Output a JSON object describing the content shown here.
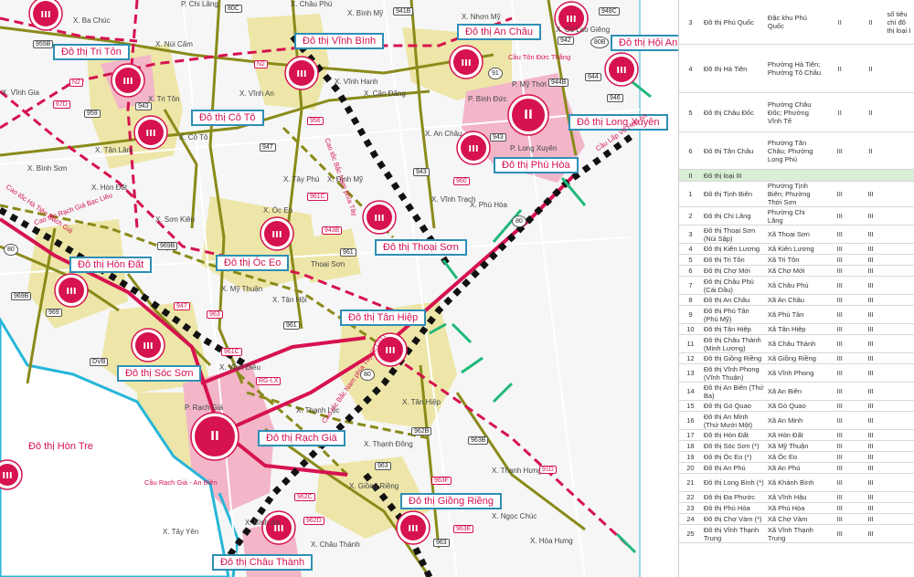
{
  "colors": {
    "urban_red": "#d6124f",
    "label_border": "#2f8fb5",
    "label_text": "#d6124f",
    "yellow_zone": "#ede6a8",
    "pink_zone": "#f2b6c8",
    "olive_road": "#8a8a1a",
    "river": "#27b6d8",
    "arrow": "#1fb879",
    "group_row": "#d9efd5"
  },
  "markers": [
    {
      "text": "III"
    },
    {
      "text": "III"
    },
    {
      "text": "III"
    },
    {
      "text": "III"
    },
    {
      "text": "III"
    },
    {
      "text": "III"
    },
    {
      "text": "III"
    },
    {
      "text": "II"
    },
    {
      "text": "III"
    },
    {
      "text": "III"
    },
    {
      "text": "III"
    },
    {
      "text": "III"
    },
    {
      "text": "III"
    },
    {
      "text": "III"
    },
    {
      "text": "III"
    },
    {
      "text": "II"
    },
    {
      "text": "III"
    },
    {
      "text": "III"
    },
    {
      "text": "III"
    },
    {
      "text": "III"
    },
    {
      "text": "III"
    }
  ],
  "city_labels": [
    "Đô thị Tri Tôn",
    "Đô thị Vĩnh Bình",
    "Đô thị An Châu",
    "Đô thị Hội An",
    "Đô thị Cô Tô",
    "Đô thị Long Xuyên",
    "Đô thị Phú Hòa",
    "Đô thị Thoại Sơn",
    "Đô thị Hòn Đất",
    "Đô thị Óc Eo",
    "Đô thị Tân Hiệp",
    "Đô thị Sóc Sơn",
    "Đô thị Hòn Tre",
    "Đô thị Rạch Giá",
    "Đô thị Giồng Riềng",
    "Đô thị Châu Thành"
  ],
  "place_labels": [
    "X. Ba Chúc",
    "P. Chi Lăng",
    "X. Châu Phú",
    "X. Bình Mỹ",
    "X. Nhơn Mỹ",
    "X. Núi Cấm",
    "X. Cù Lao Giêng",
    "P. Mỹ Thới",
    "P. Bình Đức",
    "X. Vĩnh Gia",
    "X. Vĩnh An",
    "X. Vĩnh Hanh",
    "X. Cần Đăng",
    "X. Tri Tôn",
    "X. Cô Tô",
    "X. An Châu",
    "X. Tân Lâm",
    "P. Long Xuyên",
    "X. Bình Sơn",
    "X. Tây Phú",
    "X. Định Mỹ",
    "X. Hòn Đất",
    "X. Vĩnh Trạch",
    "X. Phú Hòa",
    "X. Sơn Kiên",
    "X. Óc Eo",
    "Thoại Sơn",
    "X. Mỹ Thuận",
    "X. Tân Hội",
    "X. Vĩnh Điều",
    "X. Thạnh Lộc",
    "X. Tân Hiệp",
    "P. Rạch Giá",
    "X. Thạnh Đông",
    "X. Thạnh Hưng",
    "X. Giồng Riềng",
    "X. Ngọc Chúc",
    "X. Châu Thành",
    "X. Tây Yên",
    "X. Bình An",
    "X. Hòa Hưng"
  ],
  "road_tags": [
    "80C",
    "955B",
    "N2",
    "N2",
    "941B",
    "948C",
    "942",
    "80B",
    "944",
    "944B",
    "946",
    "67D",
    "959",
    "943",
    "956",
    "947",
    "943",
    "943",
    "960",
    "961C",
    "943B",
    "961",
    "969B",
    "80",
    "969",
    "969B",
    "963",
    "947",
    "961",
    "961C",
    "RG-LX",
    "80",
    "962B",
    "DVB",
    "963B",
    "963",
    "962C",
    "962D",
    "963F",
    "963E",
    "963",
    "91D",
    "80",
    "91"
  ],
  "road_notes": [
    "Cầu Tôn Đức Thắng",
    "Cầu Lấp Vò Hòa An",
    "Cao tốc Hà Tiên Rạch Giá",
    "Cao tốc Rạch Giá Bạc Liêu",
    "Cao tốc Bắc Nam phía Tây",
    "Cầu Rạch Giá - An Biên",
    "Cao tốc Bắc Nam phía Tây (CT.01)"
  ],
  "table": {
    "rows_top": [
      {
        "no": "3",
        "name": "Đô thị Phú Quốc",
        "wards": "Đặc khu Phú Quốc",
        "now": "II",
        "plan": "II",
        "note": "số tiêu chí đô thị loại I"
      },
      {
        "no": "4",
        "name": "Đô thị Hà Tiên",
        "wards": "Phường Hà Tiên; Phường Tô Châu",
        "now": "II",
        "plan": "II",
        "note": ""
      },
      {
        "no": "5",
        "name": "Đô thị Châu Đốc",
        "wards": "Phường Châu Đốc; Phường Vĩnh Tế",
        "now": "II",
        "plan": "II",
        "note": ""
      },
      {
        "no": "6",
        "name": "Đô thị Tân Châu",
        "wards": "Phường Tân Châu; Phường Long Phú",
        "now": "III",
        "plan": "II",
        "note": ""
      }
    ],
    "group": {
      "no": "II",
      "name": "Đô thị loại III"
    },
    "rows": [
      {
        "no": "1",
        "name": "Đô thị Tịnh Biên",
        "wards": "Phường Tịnh Biên; Phường Thới Sơn",
        "now": "III",
        "plan": "III"
      },
      {
        "no": "2",
        "name": "Đô thị Chi Lăng",
        "wards": "Phường Chi Lăng",
        "now": "III",
        "plan": "III"
      },
      {
        "no": "3",
        "name": "Đô thị Thoại Sơn (Núi Sập)",
        "wards": "Xã Thoại Sơn",
        "now": "III",
        "plan": "III"
      },
      {
        "no": "4",
        "name": "Đô thị Kiên Lương",
        "wards": "Xã Kiên Lương",
        "now": "III",
        "plan": "III"
      },
      {
        "no": "5",
        "name": "Đô thị Tri Tôn",
        "wards": "Xã Tri Tôn",
        "now": "III",
        "plan": "III"
      },
      {
        "no": "6",
        "name": "Đô thị Chợ Mới",
        "wards": "Xã Chợ Mới",
        "now": "III",
        "plan": "III"
      },
      {
        "no": "7",
        "name": "Đô thị Châu Phú (Cái Dầu)",
        "wards": "Xã Châu Phú",
        "now": "III",
        "plan": "III"
      },
      {
        "no": "8",
        "name": "Đô thị An Châu",
        "wards": "Xã An Châu",
        "now": "III",
        "plan": "III"
      },
      {
        "no": "9",
        "name": "Đô thị Phú Tân (Phú Mỹ)",
        "wards": "Xã Phú Tân",
        "now": "III",
        "plan": "III"
      },
      {
        "no": "10",
        "name": "Đô thị Tân Hiệp",
        "wards": "Xã Tân Hiệp",
        "now": "III",
        "plan": "III"
      },
      {
        "no": "11",
        "name": "Đô thị Châu Thành (Minh Lương)",
        "wards": "Xã Châu Thành",
        "now": "III",
        "plan": "III"
      },
      {
        "no": "12",
        "name": "Đô thị Giồng Riềng",
        "wards": "Xã Giồng Riềng",
        "now": "III",
        "plan": "III"
      },
      {
        "no": "13",
        "name": "Đô thị Vĩnh Phong (Vĩnh Thuận)",
        "wards": "Xã Vĩnh Phong",
        "now": "III",
        "plan": "III"
      },
      {
        "no": "14",
        "name": "Đô thị An Biên (Thứ Ba)",
        "wards": "Xã An Biên",
        "now": "III",
        "plan": "III"
      },
      {
        "no": "15",
        "name": "Đô thị Gò Quao",
        "wards": "Xã Gò Quao",
        "now": "III",
        "plan": "III"
      },
      {
        "no": "16",
        "name": "Đô thị An Minh (Thứ Mười Một)",
        "wards": "Xã An Minh",
        "now": "III",
        "plan": "III"
      },
      {
        "no": "17",
        "name": "Đô thị Hòn Đất",
        "wards": "Xã Hòn Đất",
        "now": "III",
        "plan": "III"
      },
      {
        "no": "18",
        "name": "Đô thị Sóc Sơn (*)",
        "wards": "Xã Mỹ Thuận",
        "now": "III",
        "plan": "III"
      },
      {
        "no": "19",
        "name": "Đô thị Óc Eo (*)",
        "wards": "Xã Óc Eo",
        "now": "III",
        "plan": "III"
      },
      {
        "no": "20",
        "name": "Đô thị An Phú",
        "wards": "Xã An Phú",
        "now": "III",
        "plan": "III"
      },
      {
        "no": "21",
        "name": "Đô thị Long Bình (*)",
        "wards": "Xã Khánh Bình",
        "now": "III",
        "plan": "III"
      },
      {
        "no": "22",
        "name": "Đô thị Đa Phước",
        "wards": "Xã Vĩnh Hậu",
        "now": "III",
        "plan": "III"
      },
      {
        "no": "23",
        "name": "Đô thị Phú Hòa",
        "wards": "Xã Phú Hòa",
        "now": "III",
        "plan": "III"
      },
      {
        "no": "24",
        "name": "Đô thị Chợ Vàm (*)",
        "wards": "Xã Chợ Vàm",
        "now": "III",
        "plan": "III"
      },
      {
        "no": "25",
        "name": "Đô thị Vĩnh Thạnh Trung",
        "wards": "Xã Vĩnh Thạnh Trung",
        "now": "III",
        "plan": "III"
      }
    ]
  }
}
